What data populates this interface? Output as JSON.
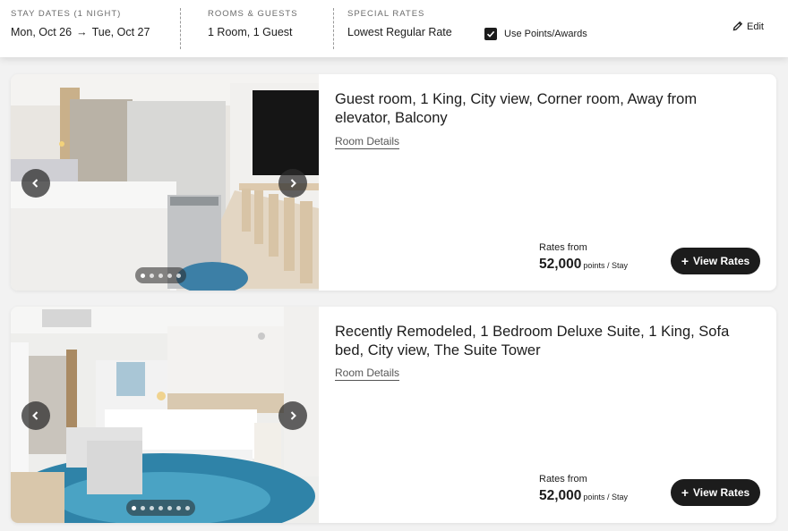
{
  "header": {
    "stay_label": "STAY DATES (1 NIGHT)",
    "check_in": "Mon, Oct 26",
    "check_out": "Tue, Oct 27",
    "guests_label": "ROOMS & GUESTS",
    "guests_value": "1 Room, 1 Guest",
    "rates_label": "SPECIAL RATES",
    "rates_value": "Lowest Regular Rate",
    "points_checkbox_label": "Use Points/Awards",
    "points_checked": true,
    "edit_label": "Edit"
  },
  "rooms": [
    {
      "title": "Guest room, 1 King, City view, Corner room, Away from elevator, Balcony",
      "details_label": "Room Details",
      "rates_from_label": "Rates from",
      "rate_value": "52,000",
      "rate_unit": "points / Stay",
      "view_rates_label": "View Rates",
      "photo_count": 5,
      "active_photo": 0
    },
    {
      "title": "Recently Remodeled, 1 Bedroom Deluxe Suite, 1 King, Sofa bed, City view, The Suite Tower",
      "details_label": "Room Details",
      "rates_from_label": "Rates from",
      "rate_value": "52,000",
      "rate_unit": "points / Stay",
      "view_rates_label": "View Rates",
      "photo_count": 7,
      "active_photo": 0
    }
  ]
}
